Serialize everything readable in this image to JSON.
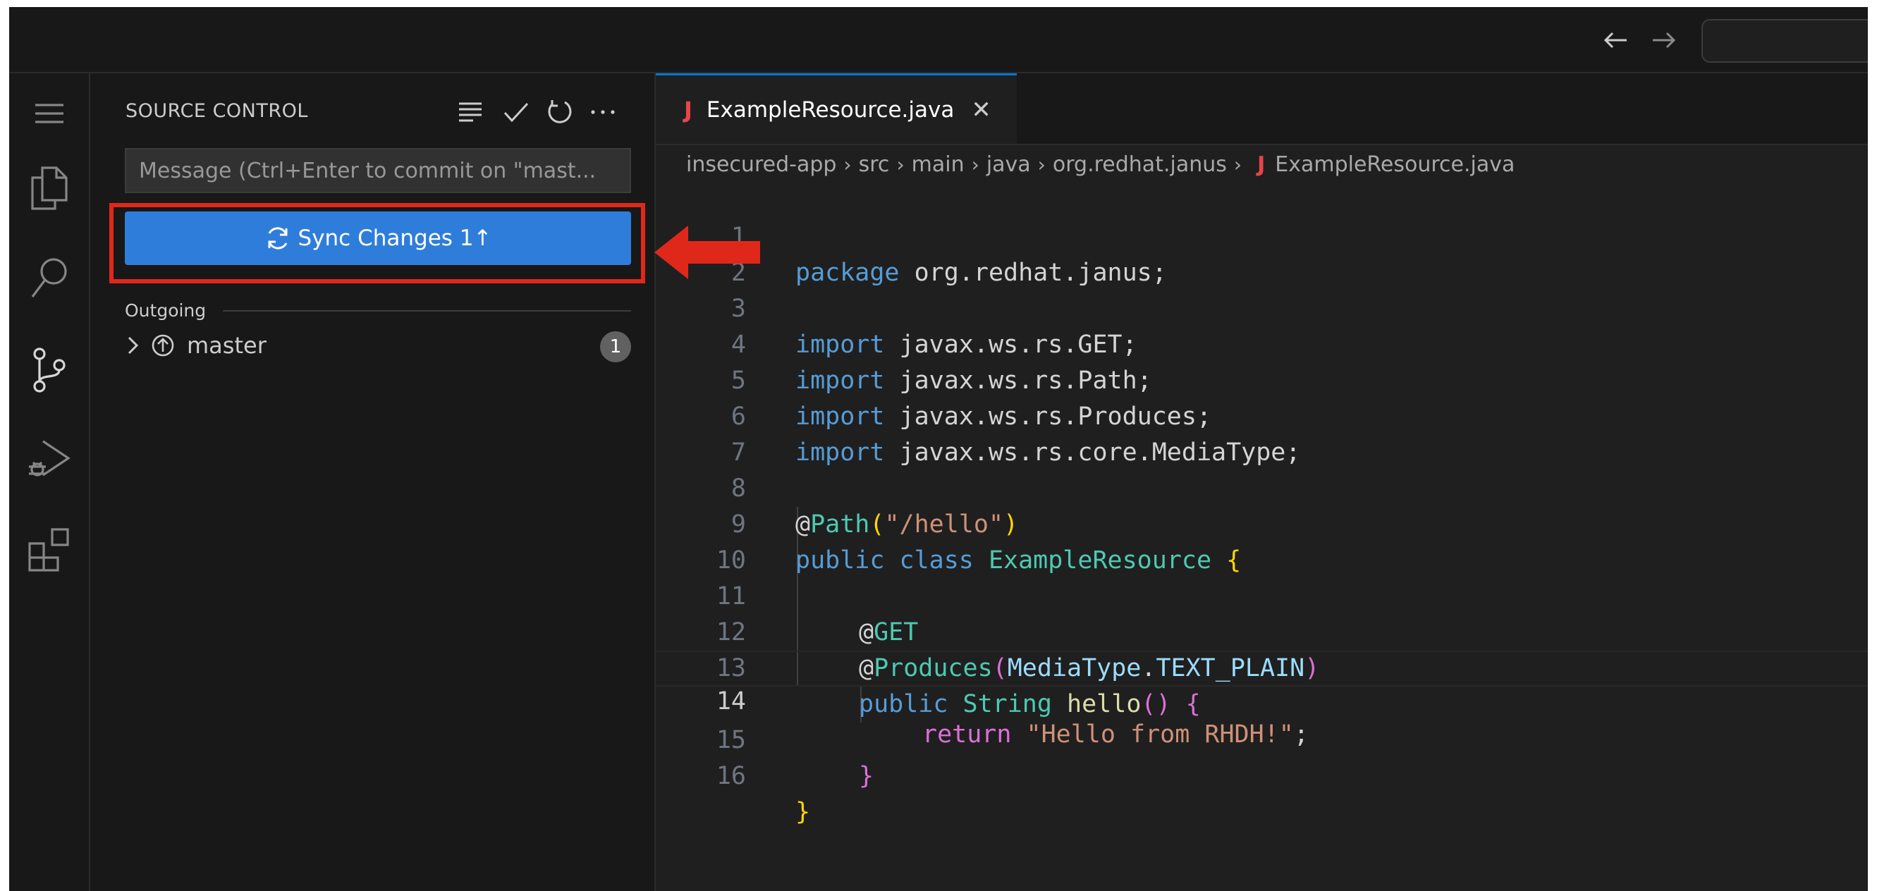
{
  "titlebar": {
    "back_icon": "arrow-left-icon",
    "forward_icon": "arrow-right-icon"
  },
  "activitybar": {
    "items": [
      "menu-icon",
      "explorer-icon",
      "search-icon",
      "source-control-icon",
      "run-debug-icon",
      "extensions-icon"
    ]
  },
  "sidebar": {
    "title": "SOURCE CONTROL",
    "actions": [
      "view-as-list-icon",
      "commit-check-icon",
      "refresh-icon",
      "more-actions-icon"
    ],
    "commit_placeholder": "Message (Ctrl+Enter to commit on \"mast...",
    "sync_button": {
      "label": "Sync Changes 1↑",
      "icon": "sync-icon"
    },
    "outgoing_label": "Outgoing",
    "branch": {
      "name": "master",
      "count": "1"
    }
  },
  "editor": {
    "tab": {
      "label": "ExampleResource.java",
      "icon_letter": "J"
    },
    "breadcrumb": [
      "insecured-app",
      "src",
      "main",
      "java",
      "org.redhat.janus",
      "ExampleResource.java"
    ],
    "line_numbers": [
      "1",
      "2",
      "3",
      "4",
      "5",
      "6",
      "7",
      "8",
      "9",
      "10",
      "11",
      "12",
      "13",
      "14",
      "15",
      "16"
    ],
    "code": [
      [
        "package",
        " org.redhat.janus;"
      ],
      [],
      [
        "import",
        " javax.ws.rs.GET;"
      ],
      [
        "import",
        " javax.ws.rs.Path;"
      ],
      [
        "import",
        " javax.ws.rs.Produces;"
      ],
      [
        "import",
        " javax.ws.rs.core.MediaType;"
      ],
      [],
      [
        "@",
        "Path",
        "(",
        "\"/hello\"",
        ")"
      ],
      [
        "public",
        " ",
        "class",
        " ",
        "ExampleResource",
        " ",
        "{"
      ],
      [],
      [
        "@",
        "GET"
      ],
      [
        "@",
        "Produces",
        "(",
        "MediaType",
        ".",
        "TEXT_PLAIN",
        ")"
      ],
      [
        "public",
        " ",
        "String",
        " ",
        "hello",
        "()",
        " ",
        "{"
      ],
      [
        "return",
        " ",
        "\"Hello from RHDH!\"",
        ";"
      ],
      [
        "}"
      ],
      [
        "}"
      ]
    ],
    "current_line": 14
  },
  "annotation": {
    "color": "#e0281a"
  },
  "colors": {
    "accent": "#2f7ddb",
    "keyword": "#569cd6",
    "type": "#4ec9b0",
    "string": "#ce9178"
  }
}
